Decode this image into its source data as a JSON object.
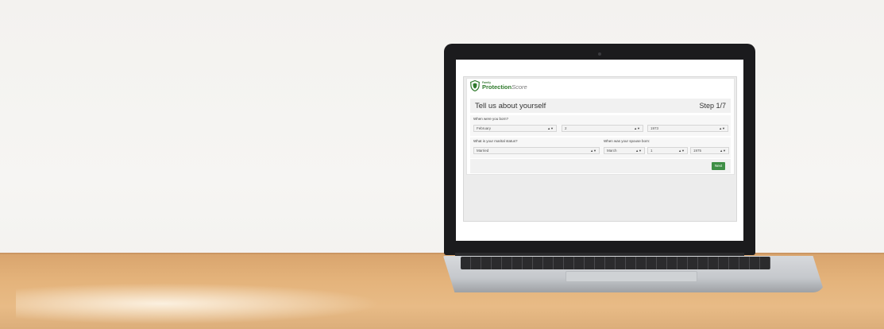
{
  "app": {
    "logo_small": "Family",
    "logo_main": "Protection",
    "logo_suffix": "Score",
    "title": "Tell us about yourself",
    "step": "Step 1/7"
  },
  "questions": {
    "birth": {
      "label": "When were you born?",
      "month": "February",
      "day": "2",
      "year": "1973"
    },
    "marital": {
      "label": "What is your marital status?",
      "value": "Married"
    },
    "spouse_birth": {
      "label": "When was your spouse born:",
      "month": "March",
      "day": "1",
      "year": "1975"
    }
  },
  "actions": {
    "next_label": "Next"
  },
  "colors": {
    "brand_green": "#2f7a2c",
    "button_green": "#3f8f46"
  }
}
